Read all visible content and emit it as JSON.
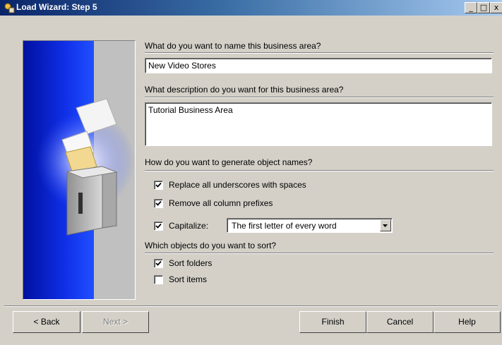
{
  "window": {
    "title": "Load Wizard: Step 5",
    "minimize_glyph": "_",
    "maximize_glyph": "□",
    "close_glyph": "x"
  },
  "name_section": {
    "question": "What do you want to name this business area?",
    "value": "New Video Stores"
  },
  "description_section": {
    "question": "What description do you want for this business area?",
    "value": "Tutorial Business Area"
  },
  "naming_section": {
    "question": "How do you want to generate object names?",
    "options": [
      {
        "label": "Replace all underscores with spaces",
        "checked": true
      },
      {
        "label": "Remove all column prefixes",
        "checked": true
      },
      {
        "label": "Capitalize:",
        "checked": true
      }
    ],
    "capitalize_selected": "The first letter of every word"
  },
  "sort_section": {
    "question": "Which objects do you want to sort?",
    "options": [
      {
        "label": "Sort folders",
        "checked": true
      },
      {
        "label": "Sort items",
        "checked": false
      }
    ]
  },
  "buttons": {
    "back": "< Back",
    "next": "Next >",
    "finish": "Finish",
    "cancel": "Cancel",
    "help": "Help"
  },
  "icons": [
    "wizard-app-icon",
    "wizard-illustration",
    "checkmark-icon",
    "dropdown-arrow-icon"
  ]
}
